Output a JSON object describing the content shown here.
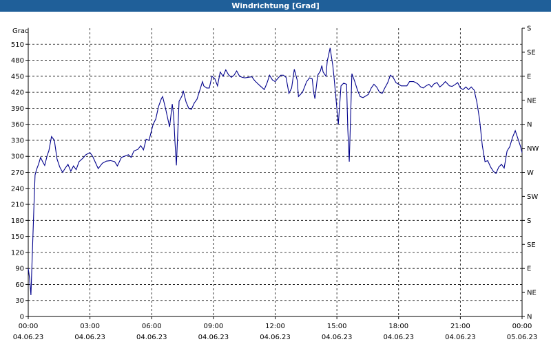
{
  "window": {
    "title": "Windrichtung [Grad]"
  },
  "chart_data": {
    "type": "line",
    "title": "Windrichtung [Grad]",
    "ylabel": "Grad",
    "xlabel": "",
    "ylim": [
      0,
      540
    ],
    "xlim_hours": [
      0,
      24
    ],
    "grid": true,
    "y_ticks": [
      0,
      30,
      60,
      90,
      120,
      150,
      180,
      210,
      240,
      270,
      300,
      330,
      360,
      390,
      420,
      450,
      480,
      510
    ],
    "y2_ticks": [
      {
        "value": 0,
        "label": "N"
      },
      {
        "value": 45,
        "label": "NE"
      },
      {
        "value": 90,
        "label": "E"
      },
      {
        "value": 135,
        "label": "SE"
      },
      {
        "value": 180,
        "label": "S"
      },
      {
        "value": 225,
        "label": "SW"
      },
      {
        "value": 270,
        "label": "W"
      },
      {
        "value": 315,
        "label": "NW"
      },
      {
        "value": 360,
        "label": "N"
      },
      {
        "value": 405,
        "label": "NE"
      },
      {
        "value": 450,
        "label": "E"
      },
      {
        "value": 495,
        "label": "SE"
      },
      {
        "value": 540,
        "label": "S"
      }
    ],
    "x_ticks": [
      {
        "hour": 0,
        "time": "00:00",
        "date": "04.06.23"
      },
      {
        "hour": 3,
        "time": "03:00",
        "date": "04.06.23"
      },
      {
        "hour": 6,
        "time": "06:00",
        "date": "04.06.23"
      },
      {
        "hour": 9,
        "time": "09:00",
        "date": "04.06.23"
      },
      {
        "hour": 12,
        "time": "12:00",
        "date": "04.06.23"
      },
      {
        "hour": 15,
        "time": "15:00",
        "date": "04.06.23"
      },
      {
        "hour": 18,
        "time": "18:00",
        "date": "04.06.23"
      },
      {
        "hour": 21,
        "time": "21:00",
        "date": "04.06.23"
      },
      {
        "hour": 24,
        "time": "00:00",
        "date": "05.06.23"
      }
    ],
    "series": [
      {
        "color": "#00008b",
        "points": [
          [
            0.0,
            90
          ],
          [
            0.07,
            70
          ],
          [
            0.13,
            40
          ],
          [
            0.2,
            120
          ],
          [
            0.27,
            200
          ],
          [
            0.33,
            265
          ],
          [
            0.4,
            275
          ],
          [
            0.5,
            285
          ],
          [
            0.6,
            298
          ],
          [
            0.7,
            290
          ],
          [
            0.8,
            283
          ],
          [
            0.93,
            303
          ],
          [
            1.0,
            310
          ],
          [
            1.13,
            337
          ],
          [
            1.27,
            330
          ],
          [
            1.4,
            295
          ],
          [
            1.53,
            280
          ],
          [
            1.67,
            270
          ],
          [
            1.8,
            278
          ],
          [
            1.93,
            285
          ],
          [
            2.07,
            272
          ],
          [
            2.2,
            282
          ],
          [
            2.33,
            275
          ],
          [
            2.47,
            290
          ],
          [
            2.67,
            297
          ],
          [
            2.8,
            303
          ],
          [
            3.0,
            307
          ],
          [
            3.13,
            300
          ],
          [
            3.27,
            288
          ],
          [
            3.4,
            277
          ],
          [
            3.6,
            287
          ],
          [
            3.8,
            291
          ],
          [
            4.0,
            292
          ],
          [
            4.2,
            290
          ],
          [
            4.33,
            282
          ],
          [
            4.53,
            298
          ],
          [
            4.67,
            300
          ],
          [
            4.87,
            303
          ],
          [
            5.0,
            298
          ],
          [
            5.13,
            310
          ],
          [
            5.33,
            313
          ],
          [
            5.47,
            320
          ],
          [
            5.6,
            312
          ],
          [
            5.73,
            332
          ],
          [
            5.87,
            330
          ],
          [
            6.07,
            360
          ],
          [
            6.2,
            370
          ],
          [
            6.33,
            393
          ],
          [
            6.47,
            408
          ],
          [
            6.53,
            412
          ],
          [
            6.67,
            390
          ],
          [
            6.8,
            367
          ],
          [
            6.87,
            355
          ],
          [
            7.0,
            398
          ],
          [
            7.07,
            375
          ],
          [
            7.13,
            328
          ],
          [
            7.2,
            283
          ],
          [
            7.33,
            403
          ],
          [
            7.47,
            413
          ],
          [
            7.53,
            423
          ],
          [
            7.67,
            402
          ],
          [
            7.8,
            390
          ],
          [
            7.93,
            388
          ],
          [
            8.07,
            400
          ],
          [
            8.2,
            407
          ],
          [
            8.33,
            423
          ],
          [
            8.47,
            440
          ],
          [
            8.53,
            432
          ],
          [
            8.67,
            428
          ],
          [
            8.8,
            428
          ],
          [
            8.93,
            450
          ],
          [
            9.07,
            445
          ],
          [
            9.2,
            432
          ],
          [
            9.33,
            458
          ],
          [
            9.47,
            450
          ],
          [
            9.6,
            462
          ],
          [
            9.73,
            453
          ],
          [
            9.87,
            448
          ],
          [
            10.0,
            452
          ],
          [
            10.13,
            460
          ],
          [
            10.27,
            450
          ],
          [
            10.4,
            448
          ],
          [
            10.53,
            447
          ],
          [
            10.67,
            448
          ],
          [
            10.87,
            449
          ],
          [
            11.0,
            442
          ],
          [
            11.13,
            437
          ],
          [
            11.27,
            432
          ],
          [
            11.47,
            425
          ],
          [
            11.6,
            437
          ],
          [
            11.73,
            452
          ],
          [
            11.87,
            443
          ],
          [
            12.0,
            440
          ],
          [
            12.13,
            446
          ],
          [
            12.27,
            452
          ],
          [
            12.4,
            452
          ],
          [
            12.53,
            448
          ],
          [
            12.67,
            418
          ],
          [
            12.8,
            428
          ],
          [
            12.93,
            463
          ],
          [
            13.07,
            443
          ],
          [
            13.13,
            412
          ],
          [
            13.33,
            420
          ],
          [
            13.53,
            440
          ],
          [
            13.67,
            447
          ],
          [
            13.8,
            445
          ],
          [
            13.87,
            420
          ],
          [
            13.93,
            408
          ],
          [
            14.07,
            452
          ],
          [
            14.2,
            460
          ],
          [
            14.27,
            470
          ],
          [
            14.33,
            458
          ],
          [
            14.47,
            450
          ],
          [
            14.53,
            478
          ],
          [
            14.67,
            503
          ],
          [
            14.8,
            470
          ],
          [
            14.87,
            445
          ],
          [
            15.0,
            390
          ],
          [
            15.07,
            360
          ],
          [
            15.2,
            432
          ],
          [
            15.33,
            437
          ],
          [
            15.47,
            435
          ],
          [
            15.53,
            350
          ],
          [
            15.6,
            290
          ],
          [
            15.73,
            455
          ],
          [
            15.87,
            440
          ],
          [
            16.0,
            424
          ],
          [
            16.13,
            412
          ],
          [
            16.27,
            410
          ],
          [
            16.53,
            416
          ],
          [
            16.67,
            428
          ],
          [
            16.8,
            435
          ],
          [
            16.93,
            430
          ],
          [
            17.07,
            420
          ],
          [
            17.2,
            418
          ],
          [
            17.33,
            428
          ],
          [
            17.47,
            438
          ],
          [
            17.6,
            452
          ],
          [
            17.73,
            448
          ],
          [
            17.87,
            438
          ],
          [
            18.0,
            435
          ],
          [
            18.13,
            432
          ],
          [
            18.4,
            432
          ],
          [
            18.53,
            440
          ],
          [
            18.73,
            440
          ],
          [
            18.93,
            436
          ],
          [
            19.07,
            430
          ],
          [
            19.2,
            428
          ],
          [
            19.33,
            432
          ],
          [
            19.47,
            435
          ],
          [
            19.6,
            430
          ],
          [
            19.73,
            436
          ],
          [
            19.87,
            438
          ],
          [
            20.0,
            430
          ],
          [
            20.13,
            434
          ],
          [
            20.27,
            440
          ],
          [
            20.4,
            435
          ],
          [
            20.47,
            432
          ],
          [
            20.6,
            431
          ],
          [
            20.73,
            434
          ],
          [
            20.87,
            438
          ],
          [
            21.0,
            428
          ],
          [
            21.13,
            425
          ],
          [
            21.27,
            430
          ],
          [
            21.4,
            425
          ],
          [
            21.53,
            430
          ],
          [
            21.67,
            424
          ],
          [
            21.8,
            402
          ],
          [
            21.93,
            370
          ],
          [
            22.07,
            320
          ],
          [
            22.2,
            290
          ],
          [
            22.33,
            292
          ],
          [
            22.47,
            280
          ],
          [
            22.6,
            272
          ],
          [
            22.73,
            268
          ],
          [
            22.87,
            280
          ],
          [
            23.0,
            285
          ],
          [
            23.13,
            278
          ],
          [
            23.27,
            310
          ],
          [
            23.4,
            318
          ],
          [
            23.53,
            335
          ],
          [
            23.67,
            348
          ],
          [
            23.8,
            333
          ],
          [
            23.93,
            318
          ],
          [
            24.0,
            307
          ]
        ]
      }
    ]
  }
}
